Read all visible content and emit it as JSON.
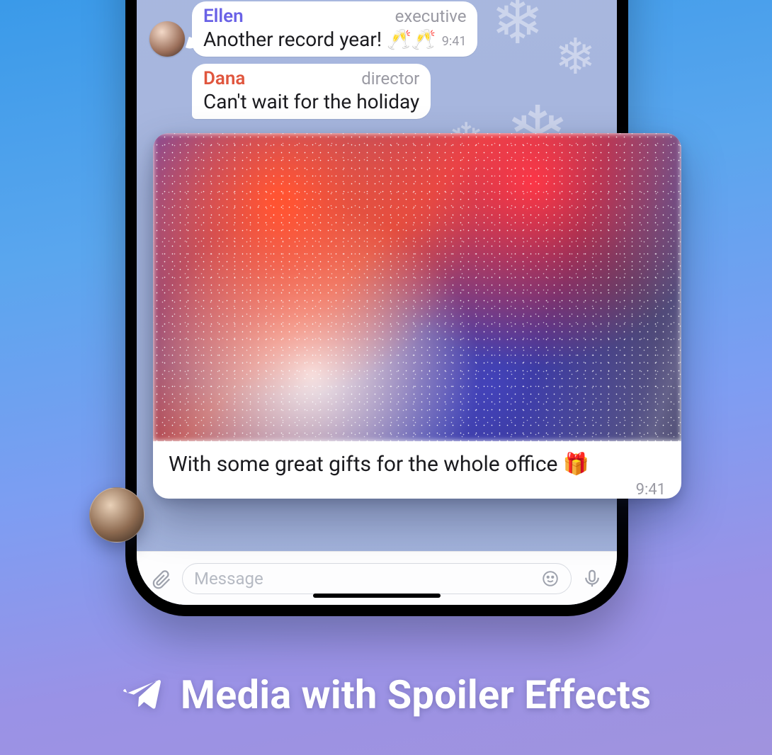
{
  "messages": [
    {
      "sender": "Ellen",
      "role": "executive",
      "name_color": "#6a62e6",
      "text": "Another record year! 🥂🥂",
      "time": "9:41"
    },
    {
      "sender": "Dana",
      "role": "director",
      "name_color": "#e0563e",
      "text": "Can't wait for the holiday"
    }
  ],
  "preview": {
    "caption": "With some great gifts for the whole office 🎁",
    "time": "9:41"
  },
  "input": {
    "placeholder": "Message"
  },
  "footer_title": "Media with Spoiler Effects"
}
